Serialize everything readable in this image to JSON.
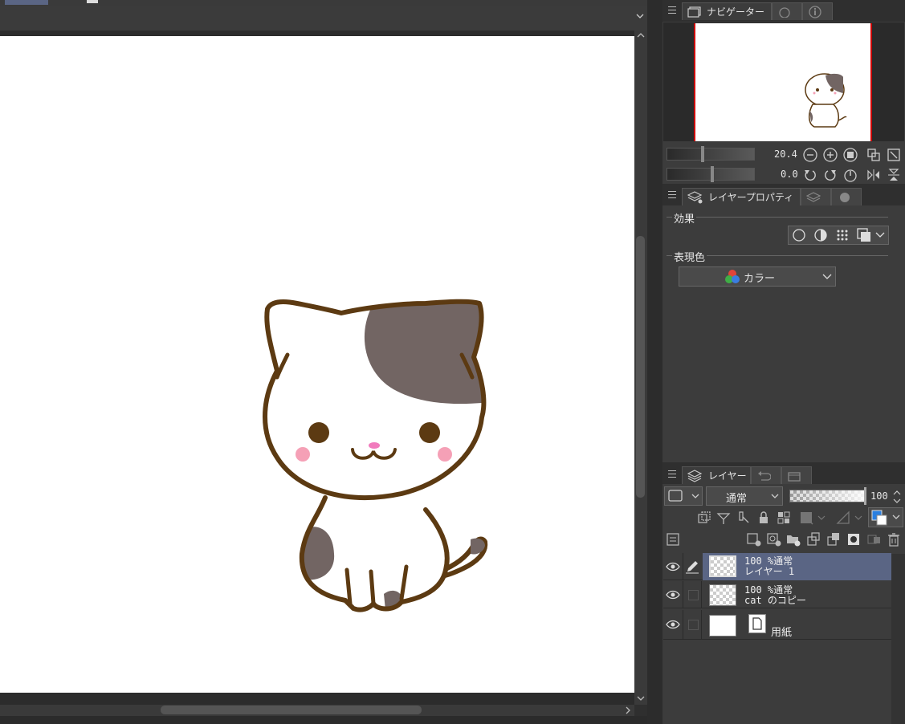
{
  "navigator": {
    "tab_label": "ナビゲーター",
    "zoom_value": "20.4",
    "rotation_value": "0.0"
  },
  "layer_property": {
    "tab_label": "レイヤープロパティ",
    "effect_label": "効果",
    "expression_color_label": "表現色",
    "expression_color_value": "カラー"
  },
  "layer_panel": {
    "tab_label": "レイヤー",
    "blend_mode": "通常",
    "opacity": "100",
    "layers": [
      {
        "opacity_mode": "100 %通常",
        "name": "レイヤー 1",
        "selected": true
      },
      {
        "opacity_mode": "100 %通常",
        "name": "cat のコピー",
        "selected": false
      },
      {
        "opacity_mode": "",
        "name": "用紙",
        "selected": false
      }
    ]
  },
  "colors": {
    "selection": "#5a6584",
    "cat_outline": "#5c3a12",
    "cat_patch": "#726563",
    "cheek": "#f5a0b6"
  }
}
